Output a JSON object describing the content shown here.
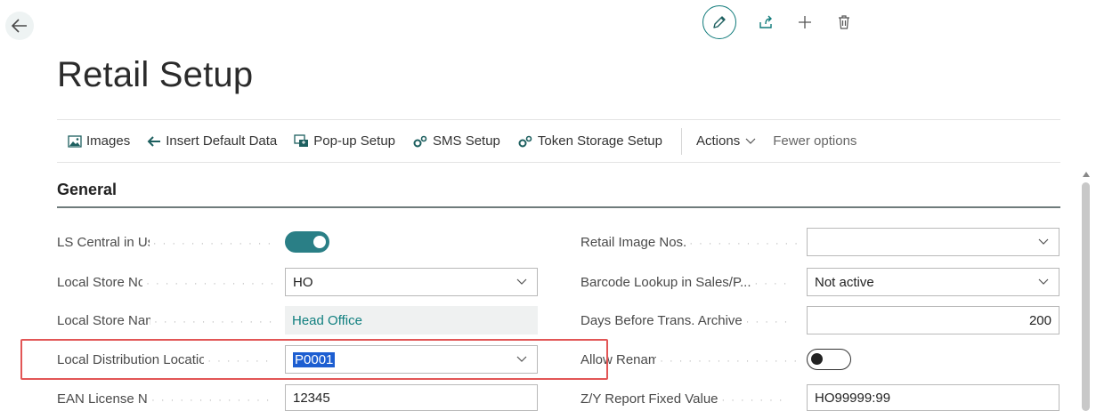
{
  "header": {
    "back_icon": "arrow-left-icon",
    "edit_icon": "pencil-icon",
    "share_icon": "share-icon",
    "add_icon": "plus-icon",
    "delete_icon": "trash-icon"
  },
  "page_title": "Retail Setup",
  "action_bar": {
    "images": "Images",
    "insert_default": "Insert Default Data",
    "popup_setup": "Pop-up Setup",
    "sms_setup": "SMS Setup",
    "token_storage": "Token Storage Setup",
    "actions": "Actions",
    "fewer_options": "Fewer options"
  },
  "section": {
    "title": "General"
  },
  "left_fields": {
    "ls_central": {
      "label": "LS Central in Use",
      "value": true
    },
    "local_store_no": {
      "label": "Local Store No.",
      "value": "HO"
    },
    "local_store_name": {
      "label": "Local Store Name",
      "value": "Head Office"
    },
    "local_distribution": {
      "label": "Local Distribution Location",
      "value": "P0001"
    },
    "ean_license": {
      "label": "EAN License No.",
      "value": "12345"
    }
  },
  "right_fields": {
    "retail_image_nos": {
      "label": "Retail Image Nos.",
      "value": ""
    },
    "barcode_lookup": {
      "label": "Barcode Lookup in Sales/P...",
      "value": "Not active"
    },
    "days_before_archive": {
      "label": "Days Before Trans. Archive",
      "value": "200"
    },
    "allow_rename": {
      "label": "Allow Rename",
      "value": false
    },
    "zy_report": {
      "label": "Z/Y Report Fixed Value",
      "value": "HO99999:99"
    }
  },
  "colors": {
    "accent": "#2a7f86",
    "highlight": "#e25656",
    "selection": "#1d5ed1"
  }
}
